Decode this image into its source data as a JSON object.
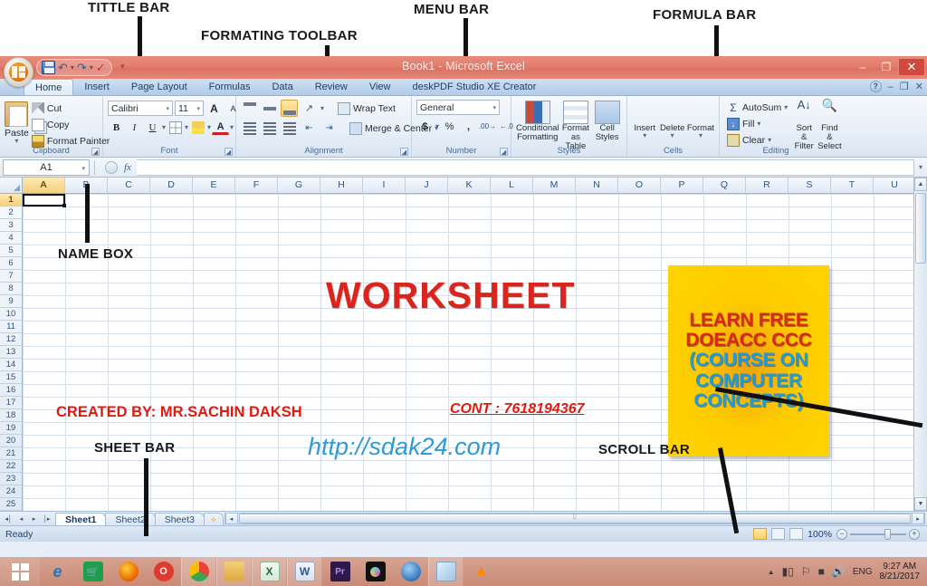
{
  "annotations": [
    {
      "id": "title-bar",
      "label": "TITTLE BAR"
    },
    {
      "id": "formatting-toolbar",
      "label": "FORMATING TOOLBAR"
    },
    {
      "id": "menu-bar",
      "label": "MENU BAR"
    },
    {
      "id": "formula-bar",
      "label": "FORMULA BAR"
    },
    {
      "id": "name-box",
      "label": "NAME BOX"
    },
    {
      "id": "sheet-bar",
      "label": "SHEET BAR"
    },
    {
      "id": "scroll-bar",
      "label": "SCROLL BAR"
    }
  ],
  "window": {
    "title": "Book1 - Microsoft Excel",
    "minimize": "–",
    "restore": "❐",
    "close": "✕"
  },
  "quick_access": {
    "save": "save-icon",
    "undo": "undo-icon",
    "redo": "redo-icon",
    "spelling": "spelling-icon",
    "customize": "▾"
  },
  "ribbon_tabs": [
    {
      "label": "Home",
      "active": true
    },
    {
      "label": "Insert",
      "active": false
    },
    {
      "label": "Page Layout",
      "active": false
    },
    {
      "label": "Formulas",
      "active": false
    },
    {
      "label": "Data",
      "active": false
    },
    {
      "label": "Review",
      "active": false
    },
    {
      "label": "View",
      "active": false
    },
    {
      "label": "deskPDF Studio XE Creator",
      "active": false
    }
  ],
  "ribbon_window_buttons": {
    "help": "?",
    "minimize": "–",
    "restore": "❐",
    "close": "✕"
  },
  "ribbon_groups": {
    "clipboard": {
      "title": "Clipboard",
      "paste": "Paste",
      "cut": "Cut",
      "copy": "Copy",
      "format_painter": "Format Painter"
    },
    "font": {
      "title": "Font",
      "font_name": "Calibri",
      "font_size": "11",
      "grow_font": "A",
      "shrink_font": "A",
      "bold": "B",
      "italic": "I",
      "underline": "U",
      "borders": "borders-icon",
      "fill_color": "fill-color-icon",
      "font_color": "A"
    },
    "alignment": {
      "title": "Alignment",
      "top_align": "top-align-icon",
      "middle_align": "middle-align-icon",
      "bottom_align": "bottom-align-icon",
      "orientation": "orientation-icon",
      "align_left": "align-left-icon",
      "align_center": "align-center-icon",
      "align_right": "align-right-icon",
      "decrease_indent": "decrease-indent-icon",
      "increase_indent": "increase-indent-icon",
      "wrap_text": "Wrap Text",
      "merge_center": "Merge & Center"
    },
    "number": {
      "title": "Number",
      "format": "General",
      "currency": "$",
      "percent": "%",
      "comma": ",",
      "increase_decimal": "increase-decimal-icon",
      "decrease_decimal": "decrease-decimal-icon"
    },
    "styles": {
      "title": "Styles",
      "conditional_formatting": "Conditional Formatting",
      "format_as_table": "Format as Table",
      "cell_styles": "Cell Styles"
    },
    "cells": {
      "title": "Cells",
      "insert": "Insert",
      "delete": "Delete",
      "format": "Format"
    },
    "editing": {
      "title": "Editing",
      "autosum": "AutoSum",
      "fill": "Fill",
      "clear": "Clear",
      "sort_filter": "Sort & Filter",
      "find_select": "Find & Select"
    }
  },
  "formula_bar": {
    "name_box_value": "A1",
    "formula_value": "",
    "cancel": "cancel-icon",
    "enter": "enter-icon",
    "insert_function": "fx"
  },
  "grid": {
    "columns": [
      "A",
      "B",
      "C",
      "D",
      "E",
      "F",
      "G",
      "H",
      "I",
      "J",
      "K",
      "L",
      "M",
      "N",
      "O",
      "P",
      "Q",
      "R",
      "S",
      "T",
      "U"
    ],
    "rows": [
      1,
      2,
      3,
      4,
      5,
      6,
      7,
      8,
      9,
      10,
      11,
      12,
      13,
      14,
      15,
      16,
      17,
      18,
      19,
      20,
      21,
      22,
      23,
      24,
      25
    ],
    "selected_cell": "A1"
  },
  "sheet_content": {
    "worksheet_title": "WORKSHEET",
    "created_by": "CREATED BY: MR.SACHIN DAKSH",
    "contact": "CONT : 7618194367",
    "url": "http://sdak24.com",
    "yellow_box_lines": [
      {
        "text": "LEARN FREE",
        "color": "#d8281b"
      },
      {
        "text": "DOEACC CCC",
        "color": "#d8281b"
      },
      {
        "text": "(COURSE ON",
        "color": "#1d9ae0"
      },
      {
        "text": "COMPUTER",
        "color": "#1d9ae0"
      },
      {
        "text": "CONCEPTS)",
        "color": "#1d9ae0"
      }
    ]
  },
  "sheet_tabs": {
    "first": "⏮",
    "prev": "◀",
    "next": "▶",
    "last": "⏭",
    "tabs": [
      {
        "label": "Sheet1",
        "active": true
      },
      {
        "label": "Sheet2",
        "active": false
      },
      {
        "label": "Sheet3",
        "active": false
      }
    ],
    "insert_sheet": "insert-worksheet-icon"
  },
  "status_bar": {
    "status": "Ready",
    "view_normal": "normal-view-icon",
    "view_page_layout": "page-layout-view-icon",
    "view_page_break": "page-break-view-icon",
    "zoom": "100%",
    "zoom_out": "−",
    "zoom_in": "+"
  },
  "taskbar": {
    "start": "windows-logo-icon",
    "items": [
      {
        "name": "internet-explorer",
        "glyph": "e",
        "bg": "#1a79c4",
        "fg": "#ffffff",
        "shape": "ie"
      },
      {
        "name": "windows-store",
        "glyph": "▣",
        "bg": "#1f9e4d",
        "fg": "#ffffff",
        "shape": "store"
      },
      {
        "name": "firefox",
        "glyph": "◉",
        "bg": "#e66000",
        "fg": "#ffffff",
        "shape": "circle"
      },
      {
        "name": "opera",
        "glyph": "O",
        "bg": "#e03a2f",
        "fg": "#ffffff",
        "shape": "circle"
      },
      {
        "name": "google-chrome",
        "glyph": "◉",
        "bg": "#4a8cf7",
        "fg": "#ffffff",
        "shape": "chrome"
      },
      {
        "name": "file-explorer",
        "glyph": "▬",
        "bg": "#e3b24a",
        "fg": "#6a4a10",
        "shape": "folder"
      },
      {
        "name": "microsoft-excel",
        "glyph": "X",
        "bg": "#1d7044",
        "fg": "#ffffff",
        "shape": "doc"
      },
      {
        "name": "microsoft-word",
        "glyph": "W",
        "bg": "#2a5699",
        "fg": "#ffffff",
        "shape": "doc"
      },
      {
        "name": "adobe-premiere",
        "glyph": "Pr",
        "bg": "#2d1a4a",
        "fg": "#b38cf0",
        "shape": "square"
      },
      {
        "name": "camera-app",
        "glyph": "◉",
        "bg": "#111111",
        "fg": "#ffffff",
        "shape": "circle"
      },
      {
        "name": "media-player",
        "glyph": "◉",
        "bg": "#2b6fbb",
        "fg": "#ffffff",
        "shape": "circle"
      },
      {
        "name": "notepad-app",
        "glyph": "◰",
        "bg": "#8fb6d8",
        "fg": "#ffffff",
        "shape": "square"
      },
      {
        "name": "vlc-media-player",
        "glyph": "▲",
        "bg": "#ff8800",
        "fg": "#ffffff",
        "shape": "cone"
      }
    ],
    "tray": {
      "show_hidden": "▲",
      "network": "network-icon",
      "action_center": "flag-icon",
      "battery": "battery-icon",
      "volume": "volume-icon",
      "language": "ENG",
      "time": "9:27 AM",
      "date": "8/21/2017"
    }
  }
}
